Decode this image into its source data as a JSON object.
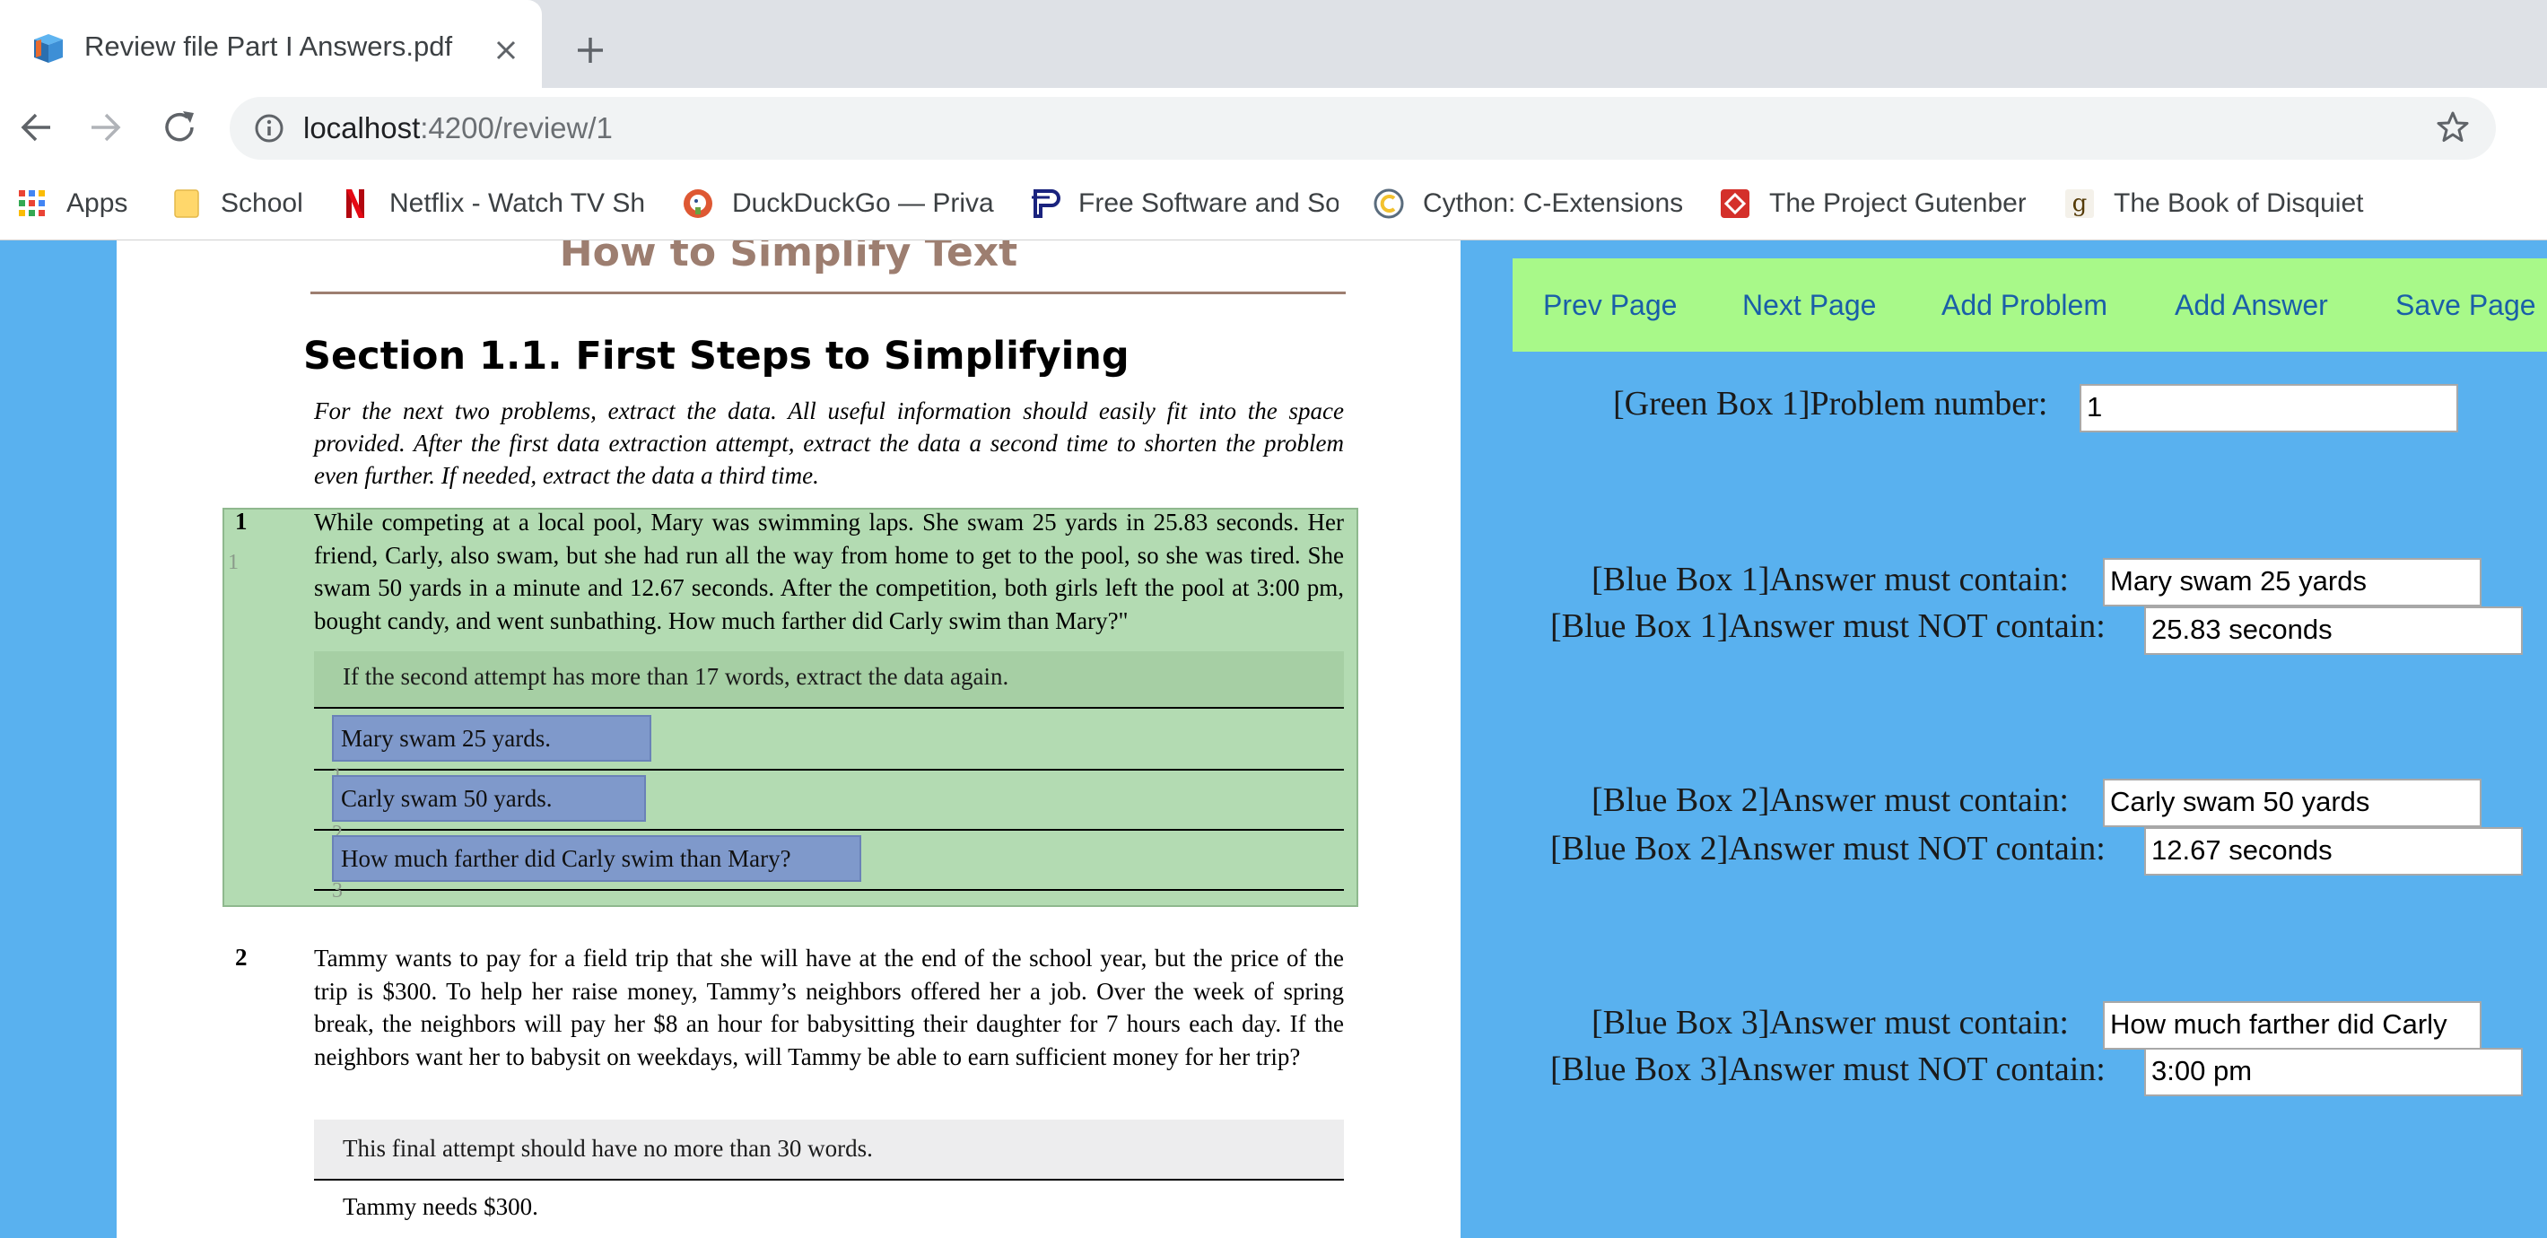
{
  "browser": {
    "tab_title": "Review file Part I Answers.pdf",
    "url_host": "localhost",
    "url_path": ":4200/review/1",
    "bookmarks": [
      {
        "label": "Apps",
        "icon": "apps-grid-icon"
      },
      {
        "label": "School",
        "icon": "folder-icon"
      },
      {
        "label": "Netflix - Watch TV Sh",
        "icon": "netflix-icon"
      },
      {
        "label": "DuckDuckGo — Priva",
        "icon": "duckduckgo-icon"
      },
      {
        "label": "Free Software and So",
        "icon": "fsf-icon"
      },
      {
        "label": "Cython: C-Extensions",
        "icon": "cython-icon"
      },
      {
        "label": "The Project Gutenber",
        "icon": "gutenberg-icon"
      },
      {
        "label": "The Book of Disquiet",
        "icon": "goodreads-icon"
      }
    ]
  },
  "document": {
    "title": "How to Simplify Text",
    "section_heading": "Section 1.1. First Steps to Simplifying",
    "instructions": "For the next two problems, extract the data. All useful information should easily fit into the space provided. After the first data extraction attempt, extract the data a second time to shorten the problem even further. If needed, extract the data a third time.",
    "problem1": {
      "number": "1",
      "text": "While competing at a local pool, Mary was swimming laps. She swam 25 yards in 25.83 seconds. Her friend, Carly, also swam, but she had run all the way from home to get to the pool, so she was tired. She swam 50 yards in a minute and 12.67 seconds. After the competition, both girls left the pool at 3:00 pm, bought candy, and went sunbathing. How much farther did Carly swim than Mary?\"",
      "attempt_note": "If the second attempt has more than 17 words, extract the data again.",
      "lines": [
        "Mary swam 25 yards.",
        "Carly swam 50 yards.",
        "How much farther did Carly swim than Mary?"
      ],
      "margin_marks": [
        "1",
        "1",
        "2",
        "3"
      ]
    },
    "problem2": {
      "number": "2",
      "text": "Tammy wants to pay for a field trip that she will have at the end of the school year, but the price of the trip is $300. To help her raise money, Tammy’s neighbors offered her a job. Over the week of spring break, the neighbors will pay her $8 an hour for babysitting their daughter for 7 hours each day. If the neighbors want her to babysit on weekdays, will Tammy be able to earn sufficient money for her trip?",
      "attempt_note": "This final attempt should have no more than 30 words.",
      "first_line": "Tammy needs $300."
    }
  },
  "panel": {
    "buttons": {
      "prev": "Prev Page",
      "next": "Next Page",
      "add_problem": "Add Problem",
      "add_answer": "Add Answer",
      "save": "Save Page"
    },
    "problem_number_label": "[Green Box 1]Problem number:",
    "problem_number_value": "1",
    "answers": [
      {
        "contain_label": "[Blue Box 1]Answer must contain:",
        "contain_value": "Mary swam 25 yards",
        "not_label": "[Blue Box 1]Answer must NOT contain:",
        "not_value": "25.83 seconds"
      },
      {
        "contain_label": "[Blue Box 2]Answer must contain:",
        "contain_value": "Carly swam 50 yards",
        "not_label": "[Blue Box 2]Answer must NOT contain:",
        "not_value": "12.67 seconds"
      },
      {
        "contain_label": "[Blue Box 3]Answer must contain:",
        "contain_value": "How much farther did Carly",
        "not_label": "[Blue Box 3]Answer must NOT contain:",
        "not_value": "3:00 pm"
      }
    ]
  },
  "colors": {
    "page_bg": "#59b1ef",
    "toolbar_green": "#a8f989",
    "problem_box_green": "#b3dbb2",
    "answer_box_blue": "#7f99cb",
    "title_brown": "#9d7e70"
  }
}
